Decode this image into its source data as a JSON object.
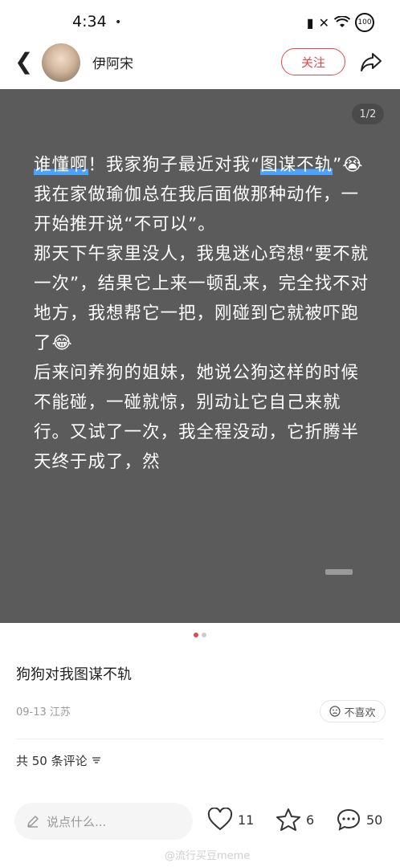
{
  "status_bar": {
    "time": "4:34",
    "dot": "•",
    "battery": "100"
  },
  "header": {
    "author_name": "伊阿宋",
    "follow_label": "关注"
  },
  "post_image": {
    "page_indicator": "1/2",
    "highlight_1": "谁懂啊",
    "text_1": "！我家狗子最近对我“",
    "highlight_2": "图谋不轨",
    "text_1_end": "”😭",
    "paragraph_2": "我在家做瑜伽总在我后面做那种动作，一开始推开说“不可以”。",
    "paragraph_3": "那天下午家里没人，我鬼迷心窍想“要不就一次”，结果它上来一顿乱来，完全找不对地方，我想帮它一把，刚碰到它就被吓跑了😂",
    "paragraph_4": "后来问养狗的姐妹，她说公狗这样的时候不能碰，一碰就惊，别动让它自己来就行。又试了一次，我全程没动，它折腾半天终于成了，然"
  },
  "post": {
    "title": "狗狗对我图谋不轨",
    "meta": "09-13 江苏",
    "dislike_label": "不喜欢",
    "comments_count_label": "共 50 条评论"
  },
  "bottom_bar": {
    "comment_placeholder": "说点什么...",
    "likes": "11",
    "stars": "6",
    "comments": "50"
  },
  "watermark": "@流行买豆meme",
  "colors": {
    "accent": "#e5484d",
    "image_bg": "#5b5b5b",
    "highlight": "#4aa3ff"
  }
}
